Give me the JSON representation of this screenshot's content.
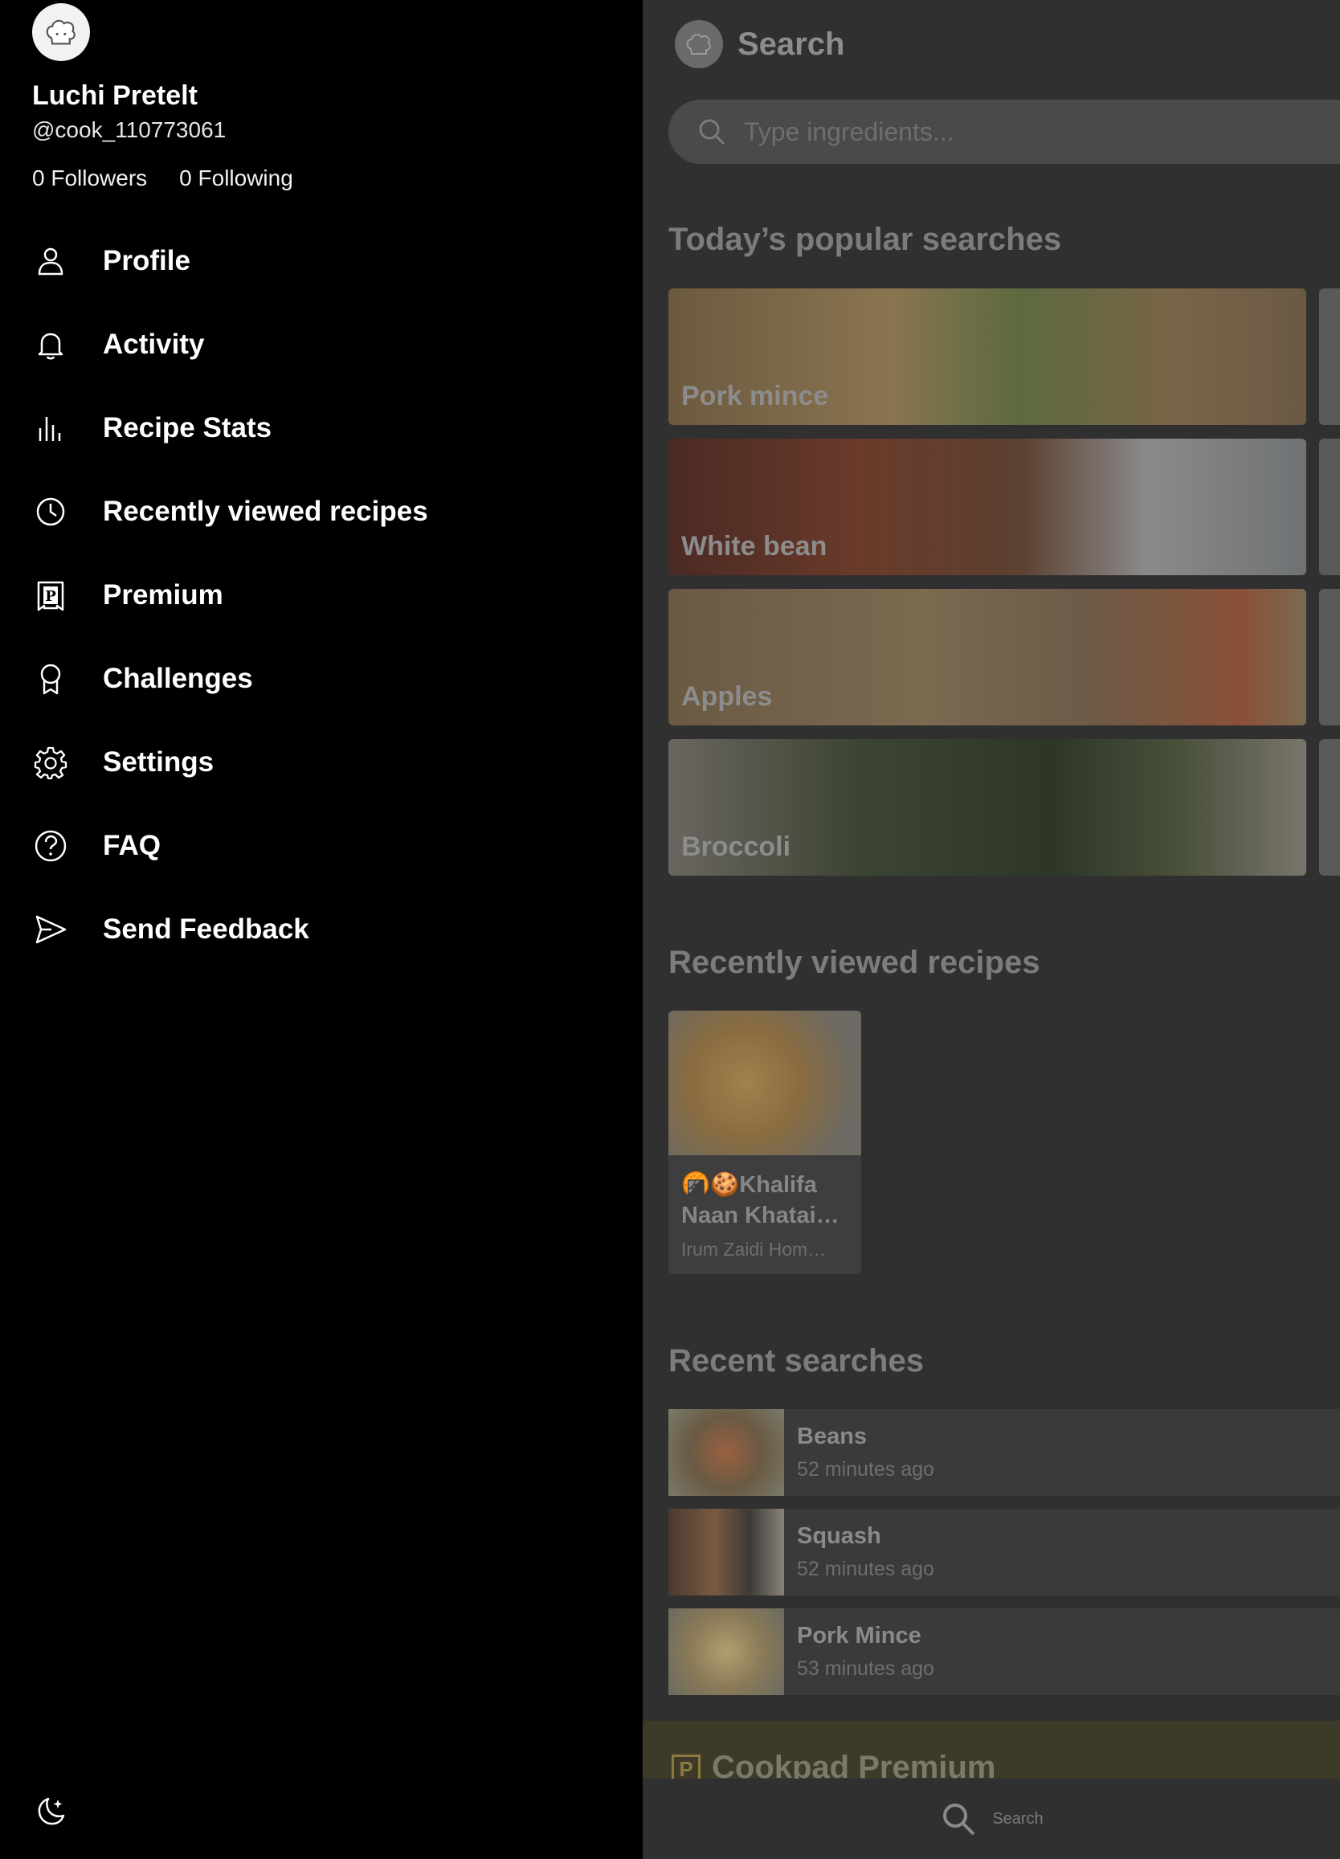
{
  "drawer": {
    "user": {
      "name": "Luchi Pretelt",
      "handle": "@cook_110773061",
      "followers": "0 Followers",
      "following": "0 Following"
    },
    "menu": [
      {
        "label": "Profile",
        "icon": "person-icon"
      },
      {
        "label": "Activity",
        "icon": "bell-icon"
      },
      {
        "label": "Recipe Stats",
        "icon": "bar-chart-icon"
      },
      {
        "label": "Recently viewed recipes",
        "icon": "clock-icon"
      },
      {
        "label": "Premium",
        "icon": "premium-p-icon"
      },
      {
        "label": "Challenges",
        "icon": "ribbon-badge-icon"
      },
      {
        "label": "Settings",
        "icon": "gear-icon"
      },
      {
        "label": "FAQ",
        "icon": "question-circle-icon"
      },
      {
        "label": "Send Feedback",
        "icon": "send-icon"
      }
    ],
    "theme_toggle_icon": "moon-icon"
  },
  "background": {
    "header_title": "Search",
    "search_placeholder": "Type ingredients...",
    "popular_title": "Today’s popular searches",
    "popular": [
      "Pork mince",
      "White bean",
      "Apples",
      "Broccoli"
    ],
    "recently_viewed_title": "Recently viewed recipes",
    "recently_viewed": [
      {
        "title": "🍘🍪Khalifa Naan Khatai…",
        "author": "Irum Zaidi Hom…"
      }
    ],
    "recent_searches_title": "Recent searches",
    "recent_searches": [
      {
        "name": "Beans",
        "time": "52 minutes ago"
      },
      {
        "name": "Squash",
        "time": "52 minutes ago"
      },
      {
        "name": "Pork Mince",
        "time": "53 minutes ago"
      }
    ],
    "premium_title": "Cookpad Premium",
    "bottom_nav_label": "Search"
  }
}
